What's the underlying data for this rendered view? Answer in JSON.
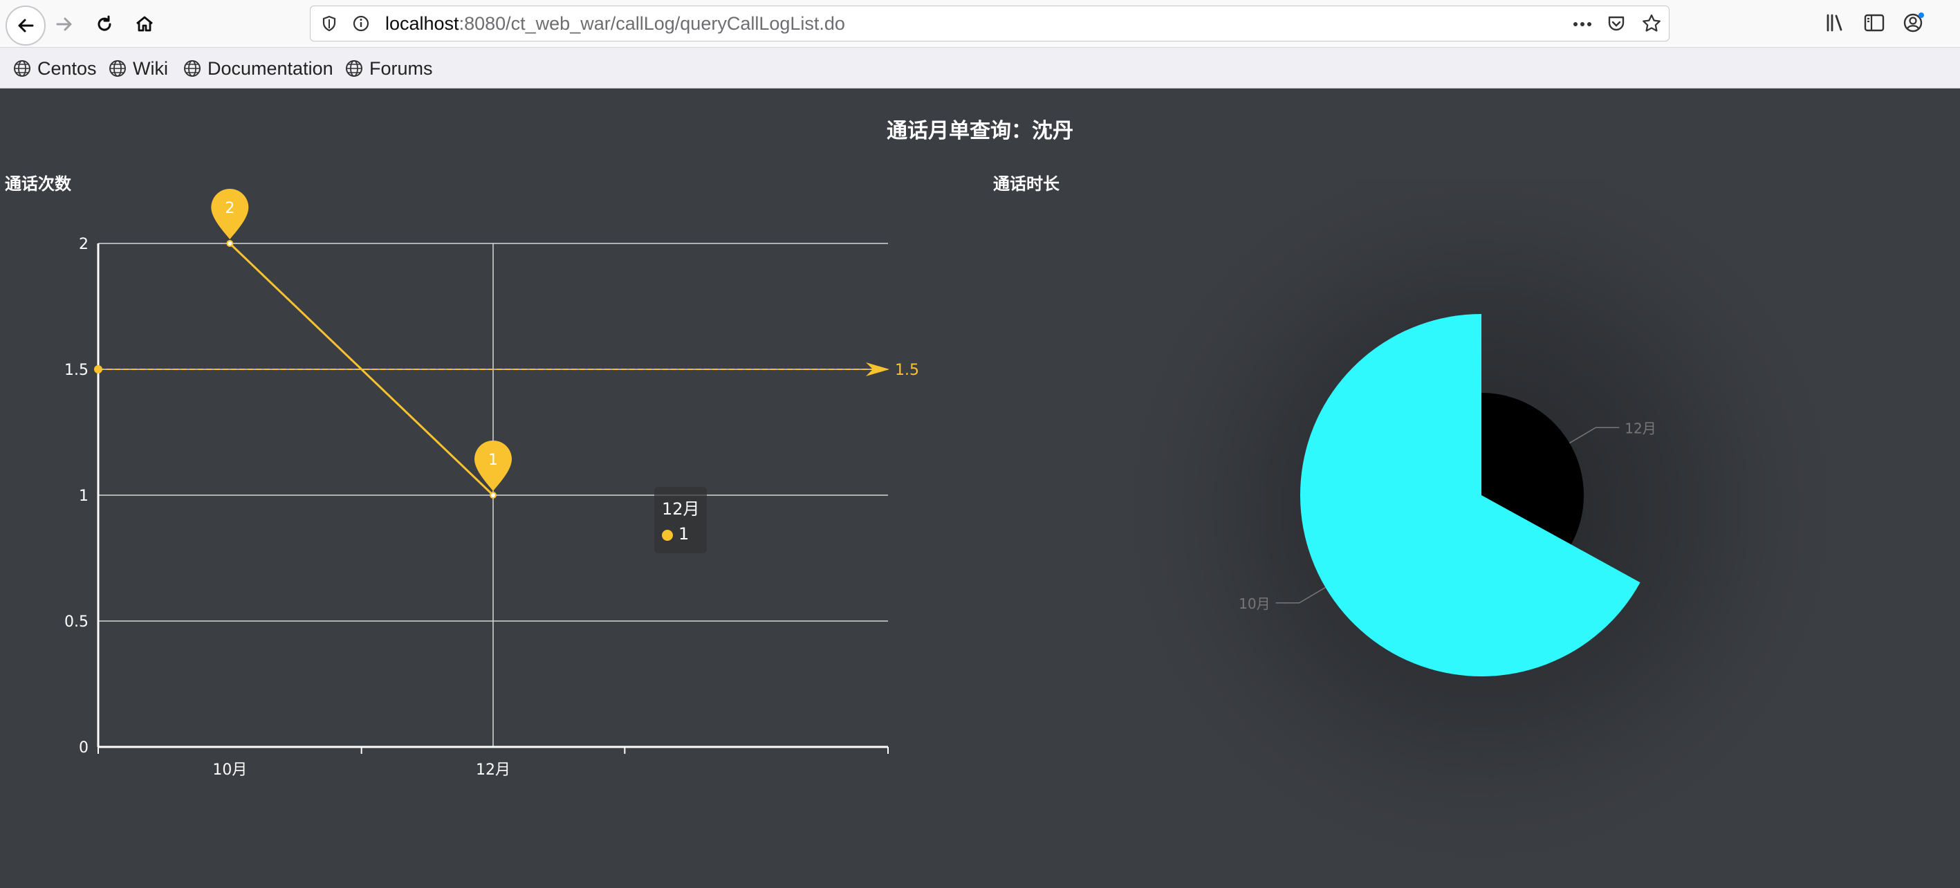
{
  "browser": {
    "url_host": "localhost",
    "url_path": ":8080/ct_web_war/callLog/queryCallLogList.do",
    "bookmarks": [
      "Centos",
      "Wiki",
      "Documentation",
      "Forums"
    ]
  },
  "page": {
    "title": "通话月单查询：沈丹"
  },
  "tooltip": {
    "title": "12月",
    "value": "1"
  },
  "chart_data": [
    {
      "type": "line",
      "title": "通话次数",
      "categories": [
        "10月",
        "12月"
      ],
      "x_ticks": [
        "10月",
        "12月"
      ],
      "values": [
        2,
        1
      ],
      "ylim": [
        0,
        2
      ],
      "yticks": [
        "0",
        "0.5",
        "1",
        "1.5",
        "2"
      ],
      "mark_points": [
        {
          "category": "10月",
          "value": 2,
          "label": "2"
        },
        {
          "category": "12月",
          "value": 1,
          "label": "1"
        }
      ],
      "mark_line": {
        "value": 1.5,
        "label": "1.5"
      },
      "grid": true,
      "color": "#f9c32f"
    },
    {
      "type": "pie",
      "title": "通话时长",
      "style": "rose",
      "slices": [
        {
          "label": "10月",
          "value": 67,
          "color": "#2ff9fd"
        },
        {
          "label": "12月",
          "value": 33,
          "color": "#000000"
        }
      ],
      "label_color": "#777777"
    }
  ]
}
